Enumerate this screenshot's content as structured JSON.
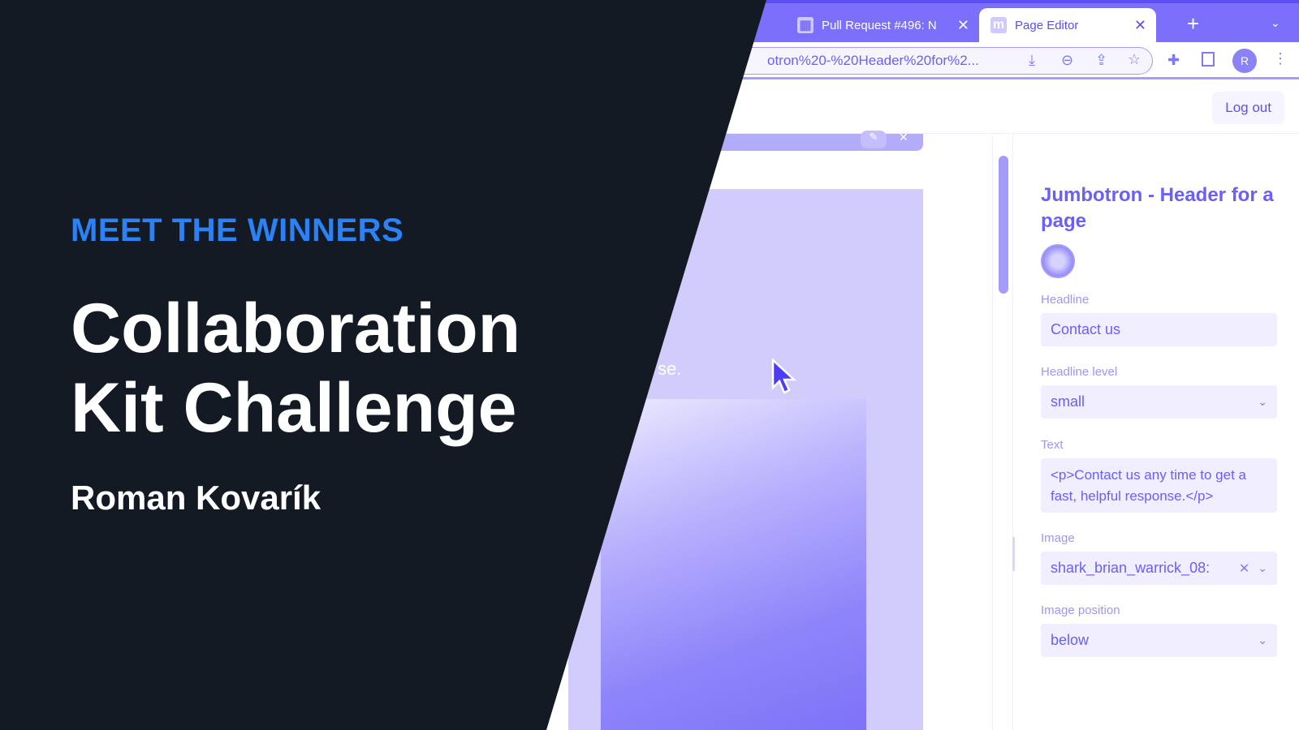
{
  "banner": {
    "kicker": "MEET THE WINNERS",
    "title_line1": "Collaboration",
    "title_line2": "Kit Challenge",
    "author": "Roman Kovarík"
  },
  "browser": {
    "tabs": [
      {
        "label": "Pull Request #496: N",
        "icon": "github-pattern-icon"
      },
      {
        "label": "Page Editor",
        "icon": "m-logo-icon",
        "active": true
      }
    ],
    "new_tab": "+",
    "url": "otron%20-%20Header%20for%2...",
    "avatar_letter": "R"
  },
  "header": {
    "logout": "Log out"
  },
  "canvas": {
    "visible_text": "se."
  },
  "panel": {
    "title": "Jumbotron - Header for a page",
    "fields": [
      {
        "label": "Headline",
        "value": "Contact us"
      },
      {
        "label": "Headline level",
        "value": "small"
      },
      {
        "label": "Text",
        "value": "<p>Contact us any time to get a fast, helpful response.</p>"
      },
      {
        "label": "Image",
        "value": "shark_brian_warrick_08:"
      },
      {
        "label": "Image position",
        "value": "below"
      }
    ]
  },
  "colors": {
    "accent": "#7b6ffb",
    "dark": "#131a24",
    "kicker": "#2b82f6"
  }
}
